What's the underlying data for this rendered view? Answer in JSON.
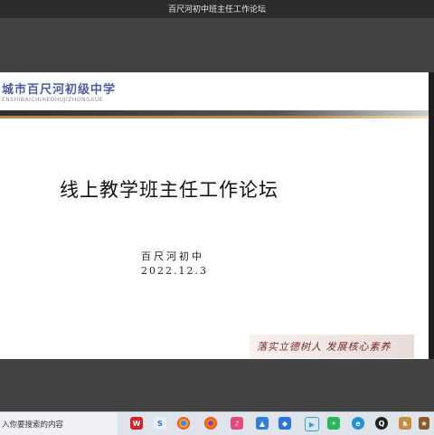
{
  "window": {
    "title": "百尺河初中班主任工作论坛"
  },
  "slide": {
    "school_cn": "城市百尺河初级中学",
    "school_en": "ENSHIBAICHIHEOHUJIZHONGXUE",
    "title": "线上教学班主任工作论坛",
    "org": "百尺河初中",
    "date": "2022.12.3",
    "motto": "落实立德树人 发展核心素养"
  },
  "taskbar": {
    "search_text": "入你要搜索的内容",
    "icons": [
      "wps-icon",
      "search-app-icon",
      "chrome-icon",
      "firefox-icon",
      "music-icon",
      "image-icon",
      "cloud-icon",
      "video-icon",
      "browser-icon",
      "wechat-icon",
      "qq-icon",
      "game-icon",
      "game2-icon",
      "app-icon"
    ]
  }
}
